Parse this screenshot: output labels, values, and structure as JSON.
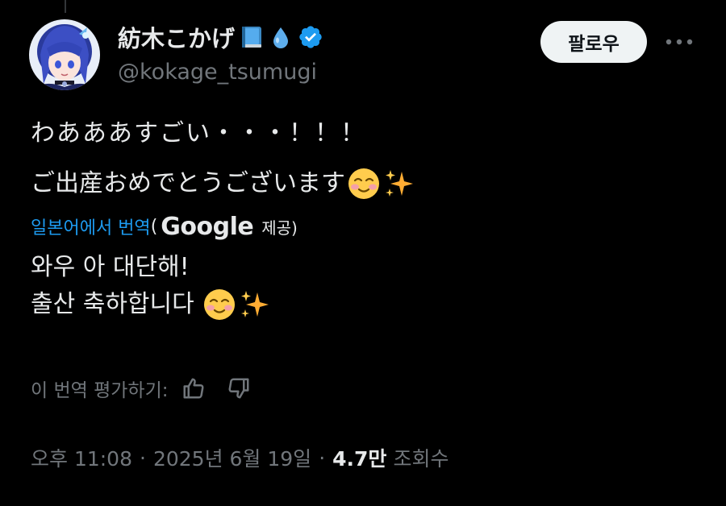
{
  "post": {
    "author": {
      "display_name": "紡木こかげ",
      "name_emojis": [
        "blue-book-emoji",
        "droplet-emoji"
      ],
      "verified_icon": "verified-badge-icon",
      "handle": "@kokage_tsumugi"
    },
    "follow_label": "팔로우",
    "more_icon": "more-horizontal-icon",
    "text_lines": [
      "わあああすごい・・・！！！",
      "ご出産おめでとうございます"
    ],
    "text_emojis": [
      "smiling-face-emoji",
      "sparkles-emoji"
    ]
  },
  "translation": {
    "link_label": "일본어에서 번역",
    "paren_open": "(",
    "provider": "Google",
    "provided_label": "제공)",
    "lines": [
      "와우 아 대단해!",
      "출산 축하합니다"
    ],
    "emojis": [
      "smiling-face-emoji",
      "sparkles-emoji"
    ]
  },
  "rating": {
    "label": "이 번역 평가하기:",
    "thumbs_up_icon": "thumbs-up-icon",
    "thumbs_down_icon": "thumbs-down-icon"
  },
  "meta": {
    "time": "오후 11:08",
    "separator": "·",
    "date": "2025년 6월 19일",
    "views_count": "4.7만",
    "views_label": "조회수"
  },
  "colors": {
    "background": "#000000",
    "text_primary": "#e7e9ea",
    "text_secondary": "#71767b",
    "link": "#1d9bf0",
    "verified": "#1d9bf0",
    "follow_bg": "#eff3f4",
    "follow_text": "#0f1419"
  }
}
